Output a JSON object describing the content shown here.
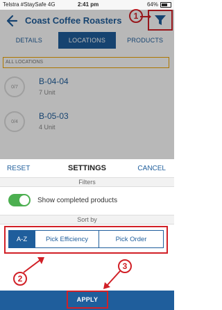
{
  "status": {
    "carrier": "Telstra #StaySafe 4G",
    "time": "2:41 pm",
    "battery": "64%"
  },
  "header": {
    "title": "Coast Coffee Roasters",
    "icons": {
      "back": "back-arrow-icon",
      "filter": "filter-icon"
    }
  },
  "tabs": [
    "DETAILS",
    "LOCATIONS",
    "PRODUCTS"
  ],
  "list": {
    "all_locations": "ALL LOCATIONS",
    "items": [
      {
        "count": "0/7",
        "location": "B-04-04",
        "units": "7 Unit"
      },
      {
        "count": "0/4",
        "location": "B-05-03",
        "units": "4 Unit"
      }
    ]
  },
  "settings": {
    "reset": "RESET",
    "title": "SETTINGS",
    "cancel": "CANCEL",
    "filters_label": "Filters",
    "show_completed": "Show completed products",
    "sort_label": "Sort by",
    "sort_options": [
      "A-Z",
      "Pick Efficiency",
      "Pick Order"
    ],
    "selected_sort": "A-Z",
    "apply": "APPLY"
  },
  "annotations": {
    "callouts": [
      "1",
      "2",
      "3"
    ]
  },
  "colors": {
    "primary": "#1f5e9c",
    "annotation": "#d12027",
    "toggle": "#4caf50"
  }
}
